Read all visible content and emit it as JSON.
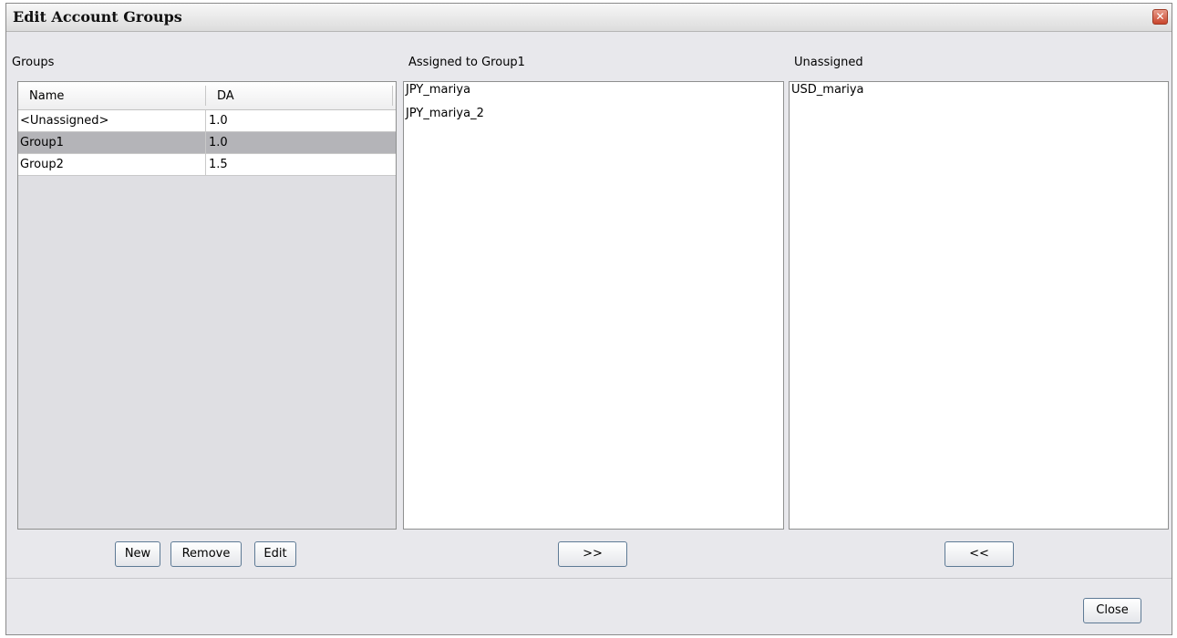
{
  "window": {
    "title": "Edit Account Groups",
    "close_glyph": "✕"
  },
  "groups": {
    "label": "Groups",
    "columns": [
      "Name",
      "DA"
    ],
    "rows": [
      {
        "name": "<Unassigned>",
        "da": "1.0",
        "selected": false
      },
      {
        "name": "Group1",
        "da": "1.0",
        "selected": true
      },
      {
        "name": "Group2",
        "da": "1.5",
        "selected": false
      }
    ],
    "buttons": {
      "new": "New",
      "remove": "Remove",
      "edit": "Edit"
    }
  },
  "assigned": {
    "label": "Assigned to Group1",
    "items": [
      "JPY_mariya",
      "JPY_mariya_2"
    ],
    "move_button": ">>"
  },
  "unassigned": {
    "label": "Unassigned",
    "items": [
      "USD_mariya"
    ],
    "move_button": "<<"
  },
  "footer": {
    "close_label": "Close"
  },
  "colors": {
    "selected_row": "#b4b4b8",
    "window_bg": "#e8e8ec",
    "close_button_red": "#c9452c"
  }
}
